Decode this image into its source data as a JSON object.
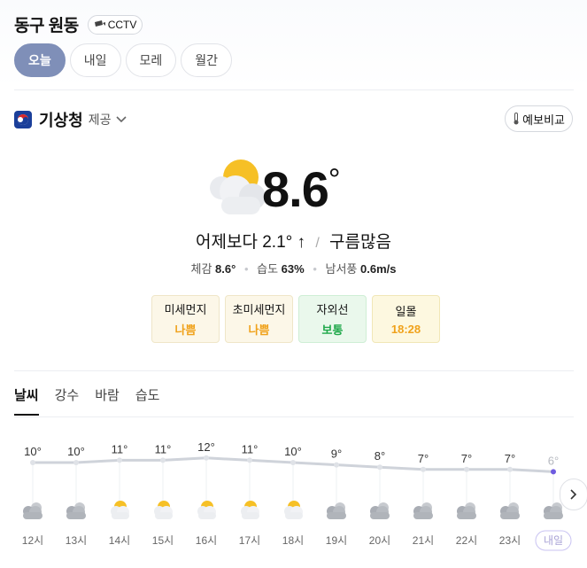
{
  "location": {
    "title": "동구 원동",
    "cctv_label": "CCTV"
  },
  "day_tabs": [
    "오늘",
    "내일",
    "모레",
    "월간"
  ],
  "provider": {
    "name": "기상청",
    "suffix": "제공",
    "compare_label": "예보비교"
  },
  "current": {
    "temp": "8.6",
    "deg": "°",
    "compare": "어제보다 2.1° ↑",
    "condition": "구름많음",
    "feels_label": "체감",
    "feels": "8.6°",
    "humidity_label": "습도",
    "humidity": "63%",
    "wind_label": "남서풍",
    "wind": "0.6m/s"
  },
  "air": [
    {
      "label": "미세먼지",
      "value": "나쁨",
      "bg": "#fcf7e8",
      "border": "#efe6c8",
      "color": "#f0a21b"
    },
    {
      "label": "초미세먼지",
      "value": "나쁨",
      "bg": "#fcf7e8",
      "border": "#efe6c8",
      "color": "#f0a21b"
    },
    {
      "label": "자외선",
      "value": "보통",
      "bg": "#eaf8ec",
      "border": "#cfeed5",
      "color": "#1fa84a"
    },
    {
      "label": "일몰",
      "value": "18:28",
      "bg": "#fdf8e0",
      "border": "#f1e7b7",
      "color": "#f0a21b"
    }
  ],
  "detail_tabs": [
    "날씨",
    "강수",
    "바람",
    "습도"
  ],
  "hourly": [
    {
      "time": "12시",
      "temp": "10°",
      "t": 10,
      "icon": "cloudy"
    },
    {
      "time": "13시",
      "temp": "10°",
      "t": 10,
      "icon": "cloudy"
    },
    {
      "time": "14시",
      "temp": "11°",
      "t": 11,
      "icon": "partly"
    },
    {
      "time": "15시",
      "temp": "11°",
      "t": 11,
      "icon": "partly"
    },
    {
      "time": "16시",
      "temp": "12°",
      "t": 12,
      "icon": "partly"
    },
    {
      "time": "17시",
      "temp": "11°",
      "t": 11,
      "icon": "partly"
    },
    {
      "time": "18시",
      "temp": "10°",
      "t": 10,
      "icon": "partly"
    },
    {
      "time": "19시",
      "temp": "9°",
      "t": 9,
      "icon": "cloudy"
    },
    {
      "time": "20시",
      "temp": "8°",
      "t": 8,
      "icon": "cloudy"
    },
    {
      "time": "21시",
      "temp": "7°",
      "t": 7,
      "icon": "cloudy"
    },
    {
      "time": "22시",
      "temp": "7°",
      "t": 7,
      "icon": "cloudy"
    },
    {
      "time": "23시",
      "temp": "7°",
      "t": 7,
      "icon": "cloudy"
    },
    {
      "time": "내일",
      "temp": "6°",
      "t": 6,
      "icon": "cloudy",
      "next_day": true
    }
  ]
}
